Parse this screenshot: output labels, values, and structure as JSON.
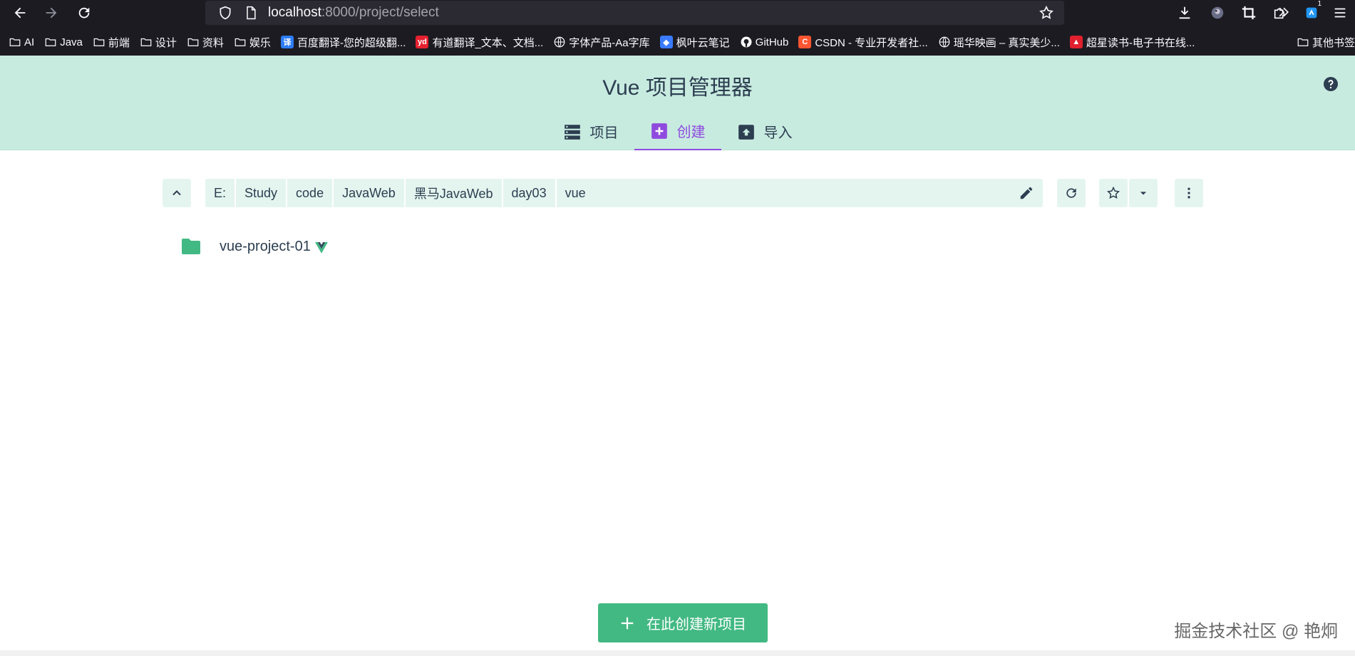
{
  "browser": {
    "url_host": "localhost",
    "url_path": ":8000/project/select",
    "extension_badge": "1",
    "bookmarks": [
      {
        "label": "AI",
        "icon": "folder-icon"
      },
      {
        "label": "Java",
        "icon": "folder-icon"
      },
      {
        "label": "前端",
        "icon": "folder-icon"
      },
      {
        "label": "设计",
        "icon": "folder-icon"
      },
      {
        "label": "资料",
        "icon": "folder-icon"
      },
      {
        "label": "娱乐",
        "icon": "folder-icon"
      },
      {
        "label": "百度翻译-您的超级翻...",
        "icon": "baidu-translate-icon",
        "color": "#2d7cf6",
        "glyph": "译"
      },
      {
        "label": "有道翻译_文本、文档...",
        "icon": "youdao-icon",
        "color": "#e5202e",
        "glyph": "yd"
      },
      {
        "label": "字体产品-Aa字库",
        "icon": "globe-icon"
      },
      {
        "label": "枫叶云笔记",
        "icon": "maple-note-icon",
        "color": "#3a7bfd",
        "glyph": "◆"
      },
      {
        "label": "GitHub",
        "icon": "github-icon"
      },
      {
        "label": "CSDN - 专业开发者社...",
        "icon": "csdn-icon",
        "color": "#fc5531",
        "glyph": "C"
      },
      {
        "label": "瑶华映画 – 真实美少...",
        "icon": "globe-icon"
      },
      {
        "label": "超星读书-电子书在线...",
        "icon": "chaoxing-icon",
        "color": "#e0202e",
        "glyph": "▲"
      }
    ],
    "other_bookmarks": "其他书签"
  },
  "app": {
    "title": "Vue 项目管理器",
    "tabs": [
      {
        "label": "项目",
        "icon": "list-icon",
        "active": false
      },
      {
        "label": "创建",
        "icon": "add-box-icon",
        "active": true
      },
      {
        "label": "导入",
        "icon": "unarchive-icon",
        "active": false
      }
    ],
    "accent_color": "#42b983",
    "active_tab_color": "#8f4bde"
  },
  "explorer": {
    "path": [
      "E:",
      "Study",
      "code",
      "JavaWeb",
      "黑马JavaWeb",
      "day03",
      "vue"
    ],
    "folders": [
      {
        "name": "vue-project-01",
        "is_vue_project": true
      }
    ]
  },
  "create_button_label": "在此创建新项目",
  "watermark": "掘金技术社区 @ 艳炯"
}
